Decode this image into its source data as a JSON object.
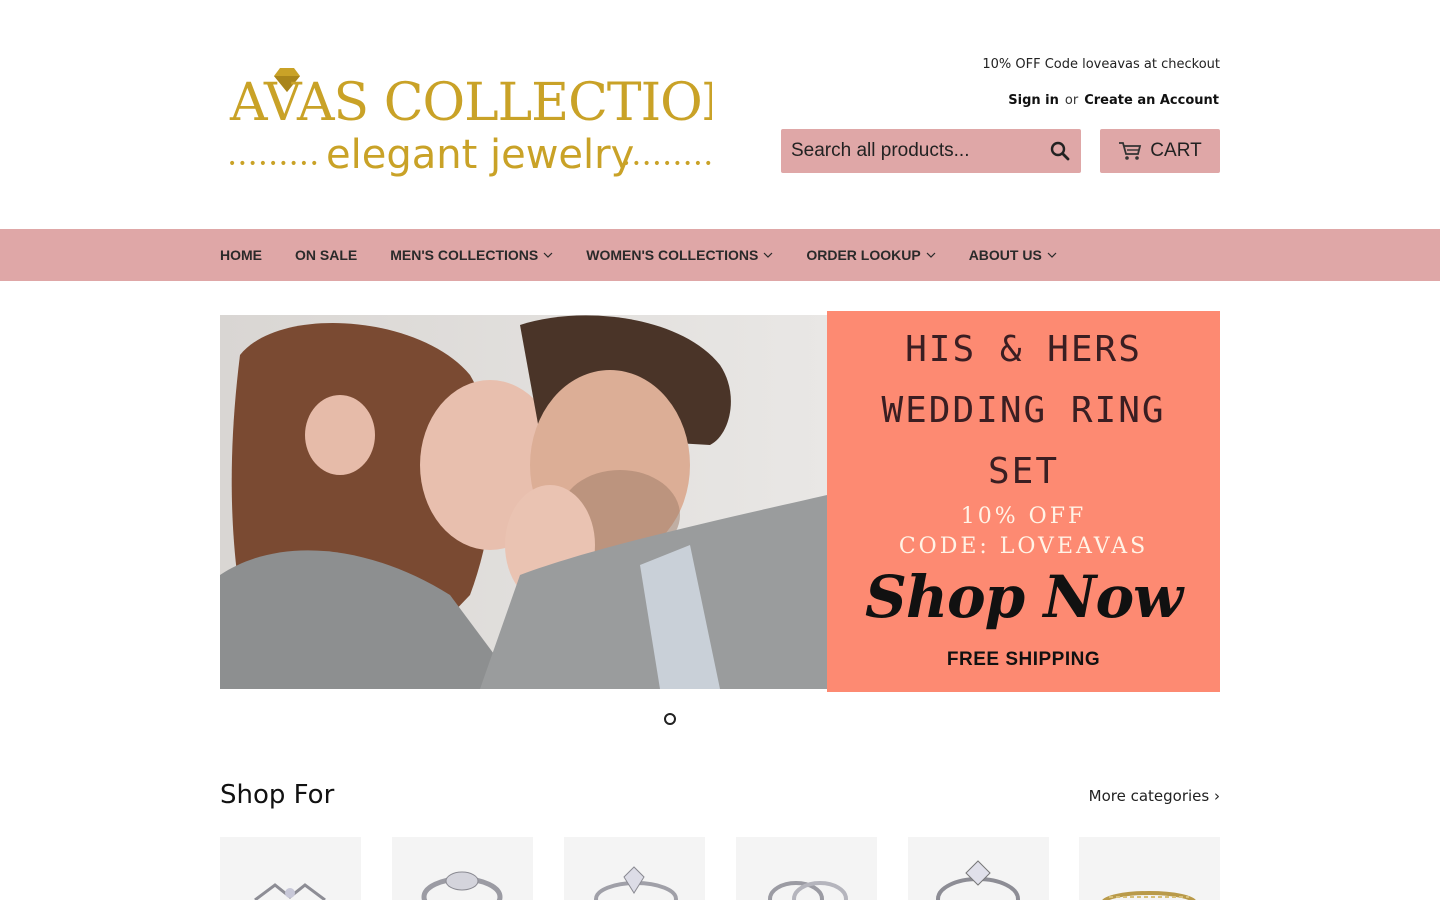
{
  "brand": {
    "name_line1": "AVAS COLLECTION",
    "name_line2": "elegant jewelry",
    "colors": {
      "gold": "#c9a227",
      "accent_pink": "#dfa7a7",
      "coral": "#fd8a72"
    }
  },
  "header": {
    "promo": "10% OFF Code loveavas at checkout",
    "sign_in": "Sign in",
    "or": "or",
    "create_account": "Create an Account",
    "search_placeholder": "Search all products...",
    "search_icon": "search-icon",
    "cart_label": "CART",
    "cart_icon": "cart-icon"
  },
  "nav": {
    "items": [
      {
        "label": "HOME",
        "dropdown": false
      },
      {
        "label": "ON SALE",
        "dropdown": false
      },
      {
        "label": "MEN'S COLLECTIONS",
        "dropdown": true
      },
      {
        "label": "WOMEN'S COLLECTIONS",
        "dropdown": true
      },
      {
        "label": "ORDER LOOKUP",
        "dropdown": true
      },
      {
        "label": "ABOUT US",
        "dropdown": true
      }
    ]
  },
  "hero": {
    "line1": "HIS & HERS",
    "line2": "WEDDING RING",
    "line3": "SET",
    "offer": "10% OFF",
    "code": "CODE: LOVEAVAS",
    "cta": "Shop Now",
    "shipping": "FREE SHIPPING"
  },
  "shop_for": {
    "title": "Shop For",
    "more": "More categories ›"
  }
}
